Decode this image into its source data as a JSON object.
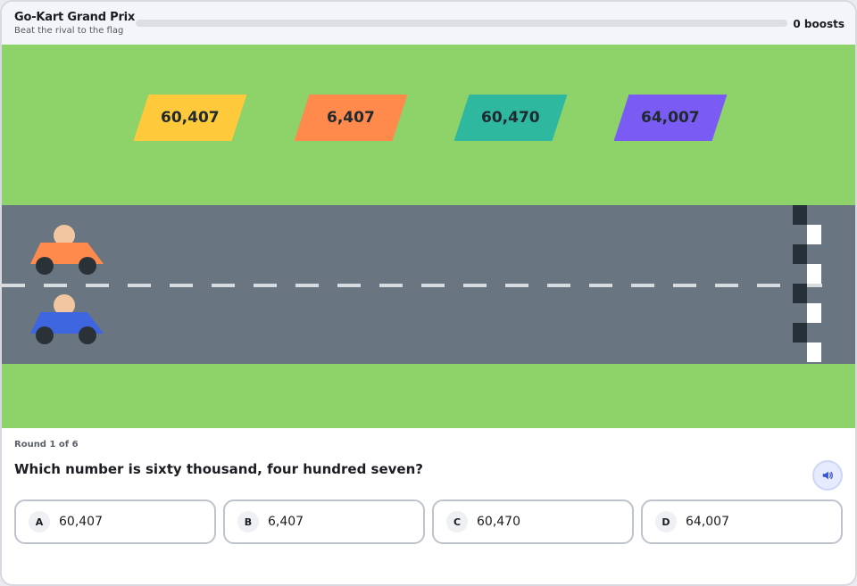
{
  "header": {
    "title": "Go-Kart Grand Prix",
    "subtitle": "Beat the rival to the flag",
    "progress_fraction": 0,
    "boosts_label": "0 boosts"
  },
  "scene": {
    "signs": [
      {
        "value": "60,407",
        "color": "#ffc93c"
      },
      {
        "value": "6,407",
        "color": "#ff8a4c"
      },
      {
        "value": "60,470",
        "color": "#2fb8a0"
      },
      {
        "value": "64,007",
        "color": "#7a5cf5"
      }
    ],
    "karts": [
      {
        "name": "rival",
        "color": "#ff8a4c"
      },
      {
        "name": "player",
        "color": "#3d66e0"
      }
    ]
  },
  "question": {
    "round_label": "Round 1 of 6",
    "text": "Which number is sixty thousand, four hundred seven?",
    "audio_icon": "speaker-icon"
  },
  "answers": [
    {
      "letter": "A",
      "value": "60,407"
    },
    {
      "letter": "B",
      "value": "6,407"
    },
    {
      "letter": "C",
      "value": "60,470"
    },
    {
      "letter": "D",
      "value": "64,007"
    }
  ]
}
